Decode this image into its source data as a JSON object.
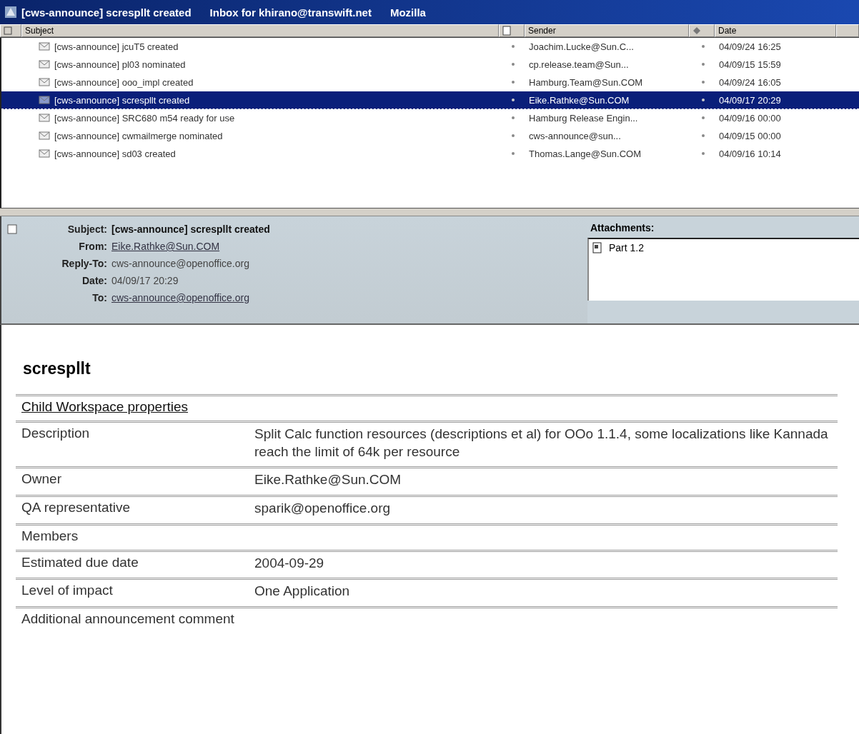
{
  "window": {
    "title": "[cws-announce] screspllt created",
    "folder": "Inbox for khirano@transwift.net",
    "app": "Mozilla"
  },
  "message_list": {
    "columns": [
      "Subject",
      "Sender",
      "Date"
    ],
    "rows": [
      {
        "subject": "[cws-announce] jcuT5 created",
        "sender": "Joachim.Lucke@Sun.C...",
        "date": "04/09/24 16:25",
        "selected": false
      },
      {
        "subject": "[cws-announce] pl03 nominated",
        "sender": "cp.release.team@Sun...",
        "date": "04/09/15 15:59",
        "selected": false
      },
      {
        "subject": "[cws-announce] ooo_impl created",
        "sender": "Hamburg.Team@Sun.COM",
        "date": "04/09/24 16:05",
        "selected": false
      },
      {
        "subject": "[cws-announce] screspllt created",
        "sender": "Eike.Rathke@Sun.COM",
        "date": "04/09/17 20:29",
        "selected": true
      },
      {
        "subject": "[cws-announce] SRC680 m54 ready for use",
        "sender": "Hamburg Release Engin...",
        "date": "04/09/16 00:00",
        "selected": false
      },
      {
        "subject": "[cws-announce] cwmailmerge nominated",
        "sender": "cws-announce@sun...",
        "date": "04/09/15 00:00",
        "selected": false
      },
      {
        "subject": "[cws-announce] sd03 created",
        "sender": "Thomas.Lange@Sun.COM",
        "date": "04/09/16 10:14",
        "selected": false
      }
    ]
  },
  "header": {
    "fields": [
      {
        "label": "Subject:",
        "value": "[cws-announce] screspllt created",
        "kind": "bold"
      },
      {
        "label": "From:",
        "value": "Eike.Rathke@Sun.COM",
        "kind": "link"
      },
      {
        "label": "Reply-To:",
        "value": "cws-announce@openoffice.org",
        "kind": "plain"
      },
      {
        "label": "Date:",
        "value": "04/09/17 20:29",
        "kind": "plain"
      },
      {
        "label": "To:",
        "value": "cws-announce@openoffice.org",
        "kind": "link"
      }
    ],
    "attachments_label": "Attachments:",
    "attachments": [
      "Part 1.2"
    ]
  },
  "body": {
    "heading": "screspllt",
    "table_title": "Child Workspace properties",
    "rows": [
      {
        "label": "Description",
        "value": "Split Calc function resources (descriptions et al) for OOo 1.1.4, some localizations like Kannada reach the limit of 64k per resource"
      },
      {
        "label": "Owner",
        "value": "Eike.Rathke@Sun.COM"
      },
      {
        "label": "QA representative",
        "value": "sparik@openoffice.org"
      },
      {
        "label": "Members"
      },
      {
        "label": "Estimated due date",
        "value": "2004-09-29"
      },
      {
        "label": "Level of impact",
        "value": "One Application"
      },
      {
        "label": "Additional announcement comment"
      }
    ]
  }
}
